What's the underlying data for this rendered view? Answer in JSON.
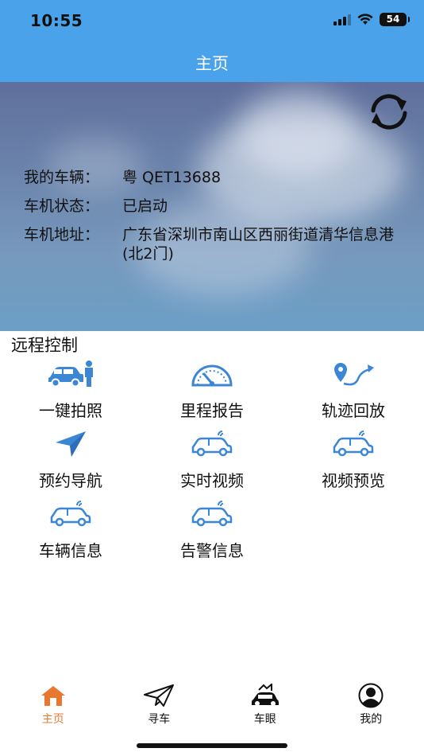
{
  "status_bar": {
    "time": "10:55",
    "battery": "54"
  },
  "nav": {
    "title": "主页"
  },
  "vehicle": {
    "rows": [
      {
        "label": "我的车辆：",
        "value": "粤 QET13688"
      },
      {
        "label": "车机状态：",
        "value": "已启动"
      },
      {
        "label": "车机地址：",
        "value": "广东省深圳市南山区西丽街道清华信息港 (北2门)"
      }
    ]
  },
  "remote": {
    "title": "远程控制",
    "items": [
      {
        "label": "一键拍照",
        "icon": "car-person-icon"
      },
      {
        "label": "里程报告",
        "icon": "speedometer-icon"
      },
      {
        "label": "轨迹回放",
        "icon": "route-icon"
      },
      {
        "label": "预约导航",
        "icon": "navigation-arrow-icon"
      },
      {
        "label": "实时视频",
        "icon": "car-signal-icon"
      },
      {
        "label": "视频预览",
        "icon": "car-signal-icon"
      },
      {
        "label": "车辆信息",
        "icon": "car-signal-icon"
      },
      {
        "label": "告警信息",
        "icon": "car-signal-icon"
      }
    ]
  },
  "tabs": [
    {
      "label": "主页",
      "icon": "home-icon",
      "active": true
    },
    {
      "label": "寻车",
      "icon": "paper-plane-icon",
      "active": false
    },
    {
      "label": "车眼",
      "icon": "car-eye-icon",
      "active": false
    },
    {
      "label": "我的",
      "icon": "user-icon",
      "active": false
    }
  ],
  "colors": {
    "primary": "#4aa3ea",
    "icon_blue": "#3c86d6",
    "tab_active": "#e9782f"
  }
}
